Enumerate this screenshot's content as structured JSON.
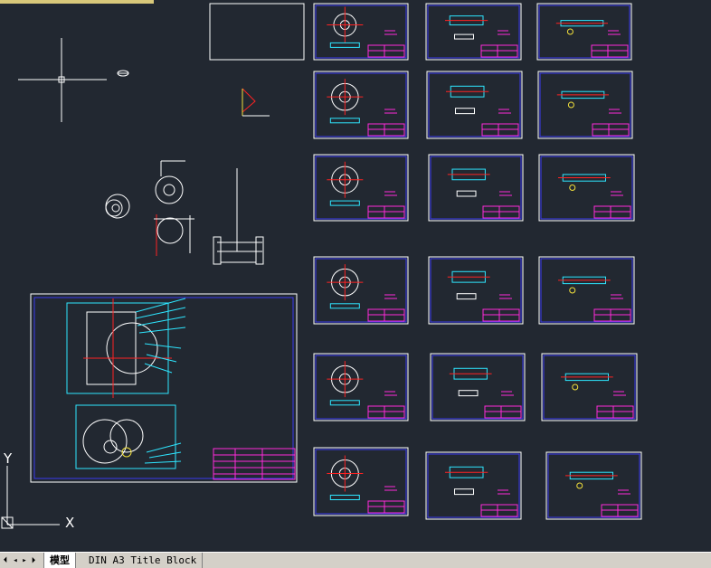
{
  "model_space": {
    "background": "#222831",
    "colors": {
      "frame": "#3a3af0",
      "geometry": "#ffffff",
      "accent": "#ff2ad9",
      "center": "#ff2222",
      "cyan": "#2ee6ff",
      "yellow": "#f3e13b",
      "green": "#22c55e"
    },
    "ucs_icon": {
      "x_label": "X",
      "y_label": "Y"
    }
  },
  "tabs": {
    "nav_first": "⏴",
    "nav_prev": "◂",
    "nav_next": "▸",
    "nav_last": "⏵",
    "model": "模型",
    "layout1": "DIN A3 Title Block"
  }
}
